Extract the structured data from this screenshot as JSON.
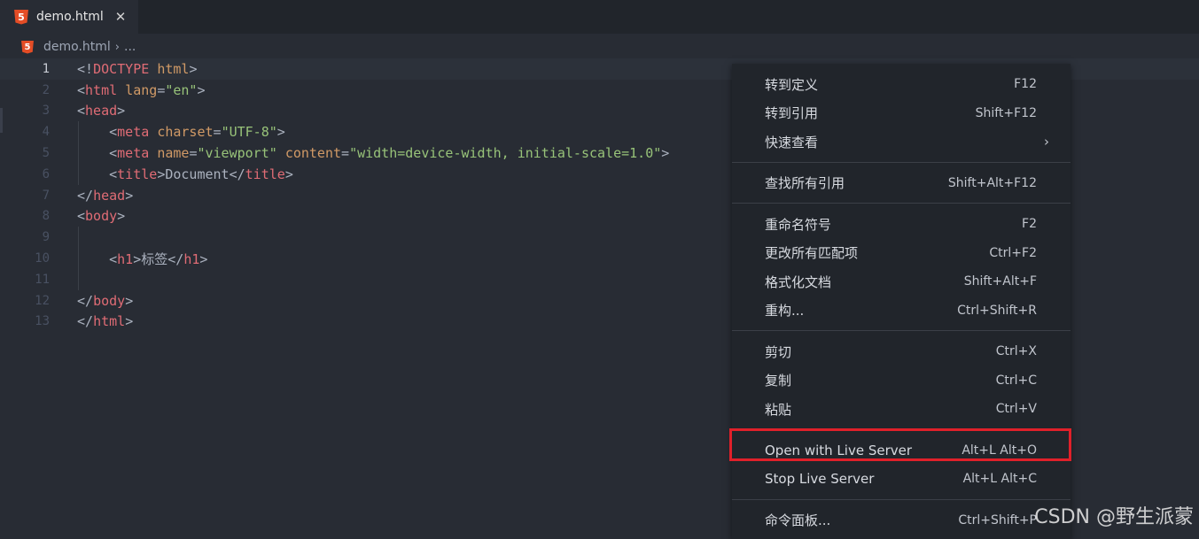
{
  "tab": {
    "icon": "html5-icon",
    "icon_glyph": "5",
    "title": "demo.html",
    "close": "✕"
  },
  "breadcrumb": {
    "file": "demo.html",
    "sep": "›",
    "ellipsis": "..."
  },
  "editor": {
    "lines": [
      {
        "n": "1",
        "tokens": [
          [
            "p",
            "<!"
          ],
          [
            "t",
            "DOCTYPE"
          ],
          [
            "p",
            " "
          ],
          [
            "a",
            "html"
          ],
          [
            "p",
            ">"
          ]
        ]
      },
      {
        "n": "2",
        "tokens": [
          [
            "p",
            "<"
          ],
          [
            "t",
            "html"
          ],
          [
            "p",
            " "
          ],
          [
            "a",
            "lang"
          ],
          [
            "p",
            "="
          ],
          [
            "s",
            "\"en\""
          ],
          [
            "p",
            ">"
          ]
        ]
      },
      {
        "n": "3",
        "tokens": [
          [
            "p",
            "<"
          ],
          [
            "t",
            "head"
          ],
          [
            "p",
            ">"
          ]
        ]
      },
      {
        "n": "4",
        "tokens": [
          [
            "p",
            "    <"
          ],
          [
            "t",
            "meta"
          ],
          [
            "p",
            " "
          ],
          [
            "a",
            "charset"
          ],
          [
            "p",
            "="
          ],
          [
            "s",
            "\"UTF-8\""
          ],
          [
            "p",
            ">"
          ]
        ]
      },
      {
        "n": "5",
        "tokens": [
          [
            "p",
            "    <"
          ],
          [
            "t",
            "meta"
          ],
          [
            "p",
            " "
          ],
          [
            "a",
            "name"
          ],
          [
            "p",
            "="
          ],
          [
            "s",
            "\"viewport\""
          ],
          [
            "p",
            " "
          ],
          [
            "a",
            "content"
          ],
          [
            "p",
            "="
          ],
          [
            "s",
            "\"width=device-width, initial-scale=1.0\""
          ],
          [
            "p",
            ">"
          ]
        ]
      },
      {
        "n": "6",
        "tokens": [
          [
            "p",
            "    <"
          ],
          [
            "t",
            "title"
          ],
          [
            "p",
            ">Document</"
          ],
          [
            "t",
            "title"
          ],
          [
            "p",
            ">"
          ]
        ]
      },
      {
        "n": "7",
        "tokens": [
          [
            "p",
            "</"
          ],
          [
            "t",
            "head"
          ],
          [
            "p",
            ">"
          ]
        ]
      },
      {
        "n": "8",
        "tokens": [
          [
            "p",
            "<"
          ],
          [
            "t",
            "body"
          ],
          [
            "p",
            ">"
          ]
        ]
      },
      {
        "n": "9",
        "tokens": []
      },
      {
        "n": "10",
        "tokens": [
          [
            "p",
            "    <"
          ],
          [
            "t",
            "h1"
          ],
          [
            "p",
            ">标签</"
          ],
          [
            "t",
            "h1"
          ],
          [
            "p",
            ">"
          ]
        ]
      },
      {
        "n": "11",
        "tokens": []
      },
      {
        "n": "12",
        "tokens": [
          [
            "p",
            "</"
          ],
          [
            "t",
            "body"
          ],
          [
            "p",
            ">"
          ]
        ]
      },
      {
        "n": "13",
        "tokens": [
          [
            "p",
            "</"
          ],
          [
            "t",
            "html"
          ],
          [
            "p",
            ">"
          ]
        ]
      }
    ],
    "current_line": "1"
  },
  "context_menu": {
    "items": [
      {
        "label": "转到定义",
        "key": "F12"
      },
      {
        "label": "转到引用",
        "key": "Shift+F12"
      },
      {
        "label": "快速查看",
        "key": "",
        "submenu": "›"
      },
      {
        "separator": true
      },
      {
        "label": "查找所有引用",
        "key": "Shift+Alt+F12"
      },
      {
        "separator": true
      },
      {
        "label": "重命名符号",
        "key": "F2"
      },
      {
        "label": "更改所有匹配项",
        "key": "Ctrl+F2"
      },
      {
        "label": "格式化文档",
        "key": "Shift+Alt+F"
      },
      {
        "label": "重构...",
        "key": "Ctrl+Shift+R"
      },
      {
        "separator": true
      },
      {
        "label": "剪切",
        "key": "Ctrl+X"
      },
      {
        "label": "复制",
        "key": "Ctrl+C"
      },
      {
        "label": "粘贴",
        "key": "Ctrl+V"
      },
      {
        "separator": true
      },
      {
        "label": "Open with Live Server",
        "key": "Alt+L Alt+O",
        "highlighted": true
      },
      {
        "label": "Stop Live Server",
        "key": "Alt+L Alt+C"
      },
      {
        "separator": true
      },
      {
        "label": "命令面板...",
        "key": "Ctrl+Shift+P"
      }
    ],
    "highlight_color": "#e0202a"
  },
  "watermark": "CSDN @野生派蒙",
  "colors": {
    "tag": "#e06c75",
    "attr": "#d19a66",
    "string": "#98c379",
    "punct": "#abb2bf",
    "background": "#282c34"
  }
}
